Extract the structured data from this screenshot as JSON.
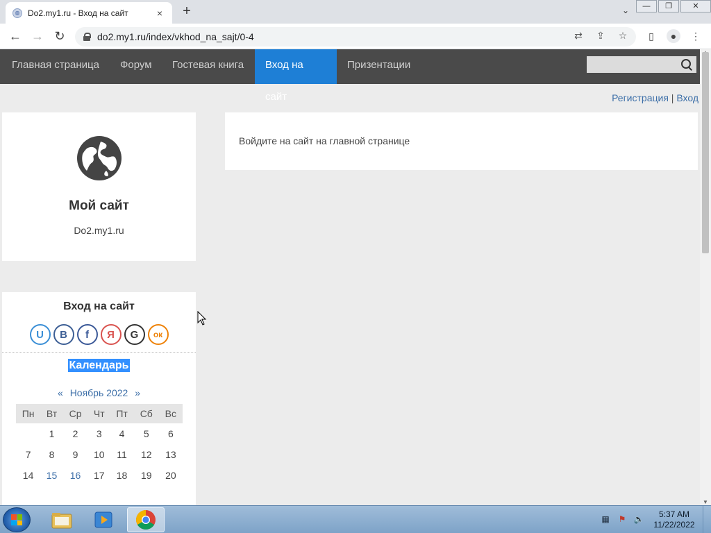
{
  "browser": {
    "tab_title": "Do2.my1.ru - Вход на сайт",
    "tab_favicon": "globe-icon",
    "close_tab": "×",
    "new_tab": "+",
    "tab_list": "⌄",
    "url": "do2.my1.ru/index/vkhod_na_sajt/0-4",
    "back": "←",
    "forward": "→",
    "reload": "↻",
    "translate": "⇄",
    "share": "⇪",
    "bookmark": "☆",
    "side_panel": "▯",
    "profile": "●",
    "menu": "⋮",
    "window": {
      "minimize": "—",
      "restore": "❐",
      "close": "✕"
    }
  },
  "site_nav": {
    "items": [
      {
        "label": "Главная страница",
        "active": false
      },
      {
        "label": "Форум",
        "active": false
      },
      {
        "label": "Гостевая книга",
        "active": false
      },
      {
        "label": "Вход на сайт",
        "active": true
      },
      {
        "label": "Призентации",
        "active": false
      }
    ],
    "search_placeholder": ""
  },
  "user_links": {
    "register": "Регистрация",
    "separator": "|",
    "login": "Вход"
  },
  "site_card": {
    "name": "Мой сайт",
    "domain": "Do2.my1.ru"
  },
  "content": {
    "message": "Войдите на сайт на главной странице"
  },
  "login": {
    "title": "Вход на сайт",
    "social": [
      {
        "name": "ucoz",
        "glyph": "U",
        "color": "#3b8fd6"
      },
      {
        "name": "vk",
        "glyph": "В",
        "color": "#3d5f95"
      },
      {
        "name": "facebook",
        "glyph": "f",
        "color": "#3b5998"
      },
      {
        "name": "yandex",
        "glyph": "Я",
        "color": "#d9534f"
      },
      {
        "name": "google",
        "glyph": "G",
        "color": "#333333"
      },
      {
        "name": "odnoklassniki",
        "glyph": "ок",
        "color": "#ee8208"
      }
    ]
  },
  "calendar": {
    "title": "Календарь",
    "prev": "«",
    "month": "Ноябрь 2022",
    "next": "»",
    "weekdays": [
      "Пн",
      "Вт",
      "Ср",
      "Чт",
      "Пт",
      "Сб",
      "Вс"
    ],
    "weeks": [
      [
        "",
        "1",
        "2",
        "3",
        "4",
        "5",
        "6"
      ],
      [
        "7",
        "8",
        "9",
        "10",
        "11",
        "12",
        "13"
      ],
      [
        "14",
        "15",
        "16",
        "17",
        "18",
        "19",
        "20"
      ]
    ]
  },
  "taskbar": {
    "clock_time": "5:37 AM",
    "clock_date": "11/22/2022"
  }
}
